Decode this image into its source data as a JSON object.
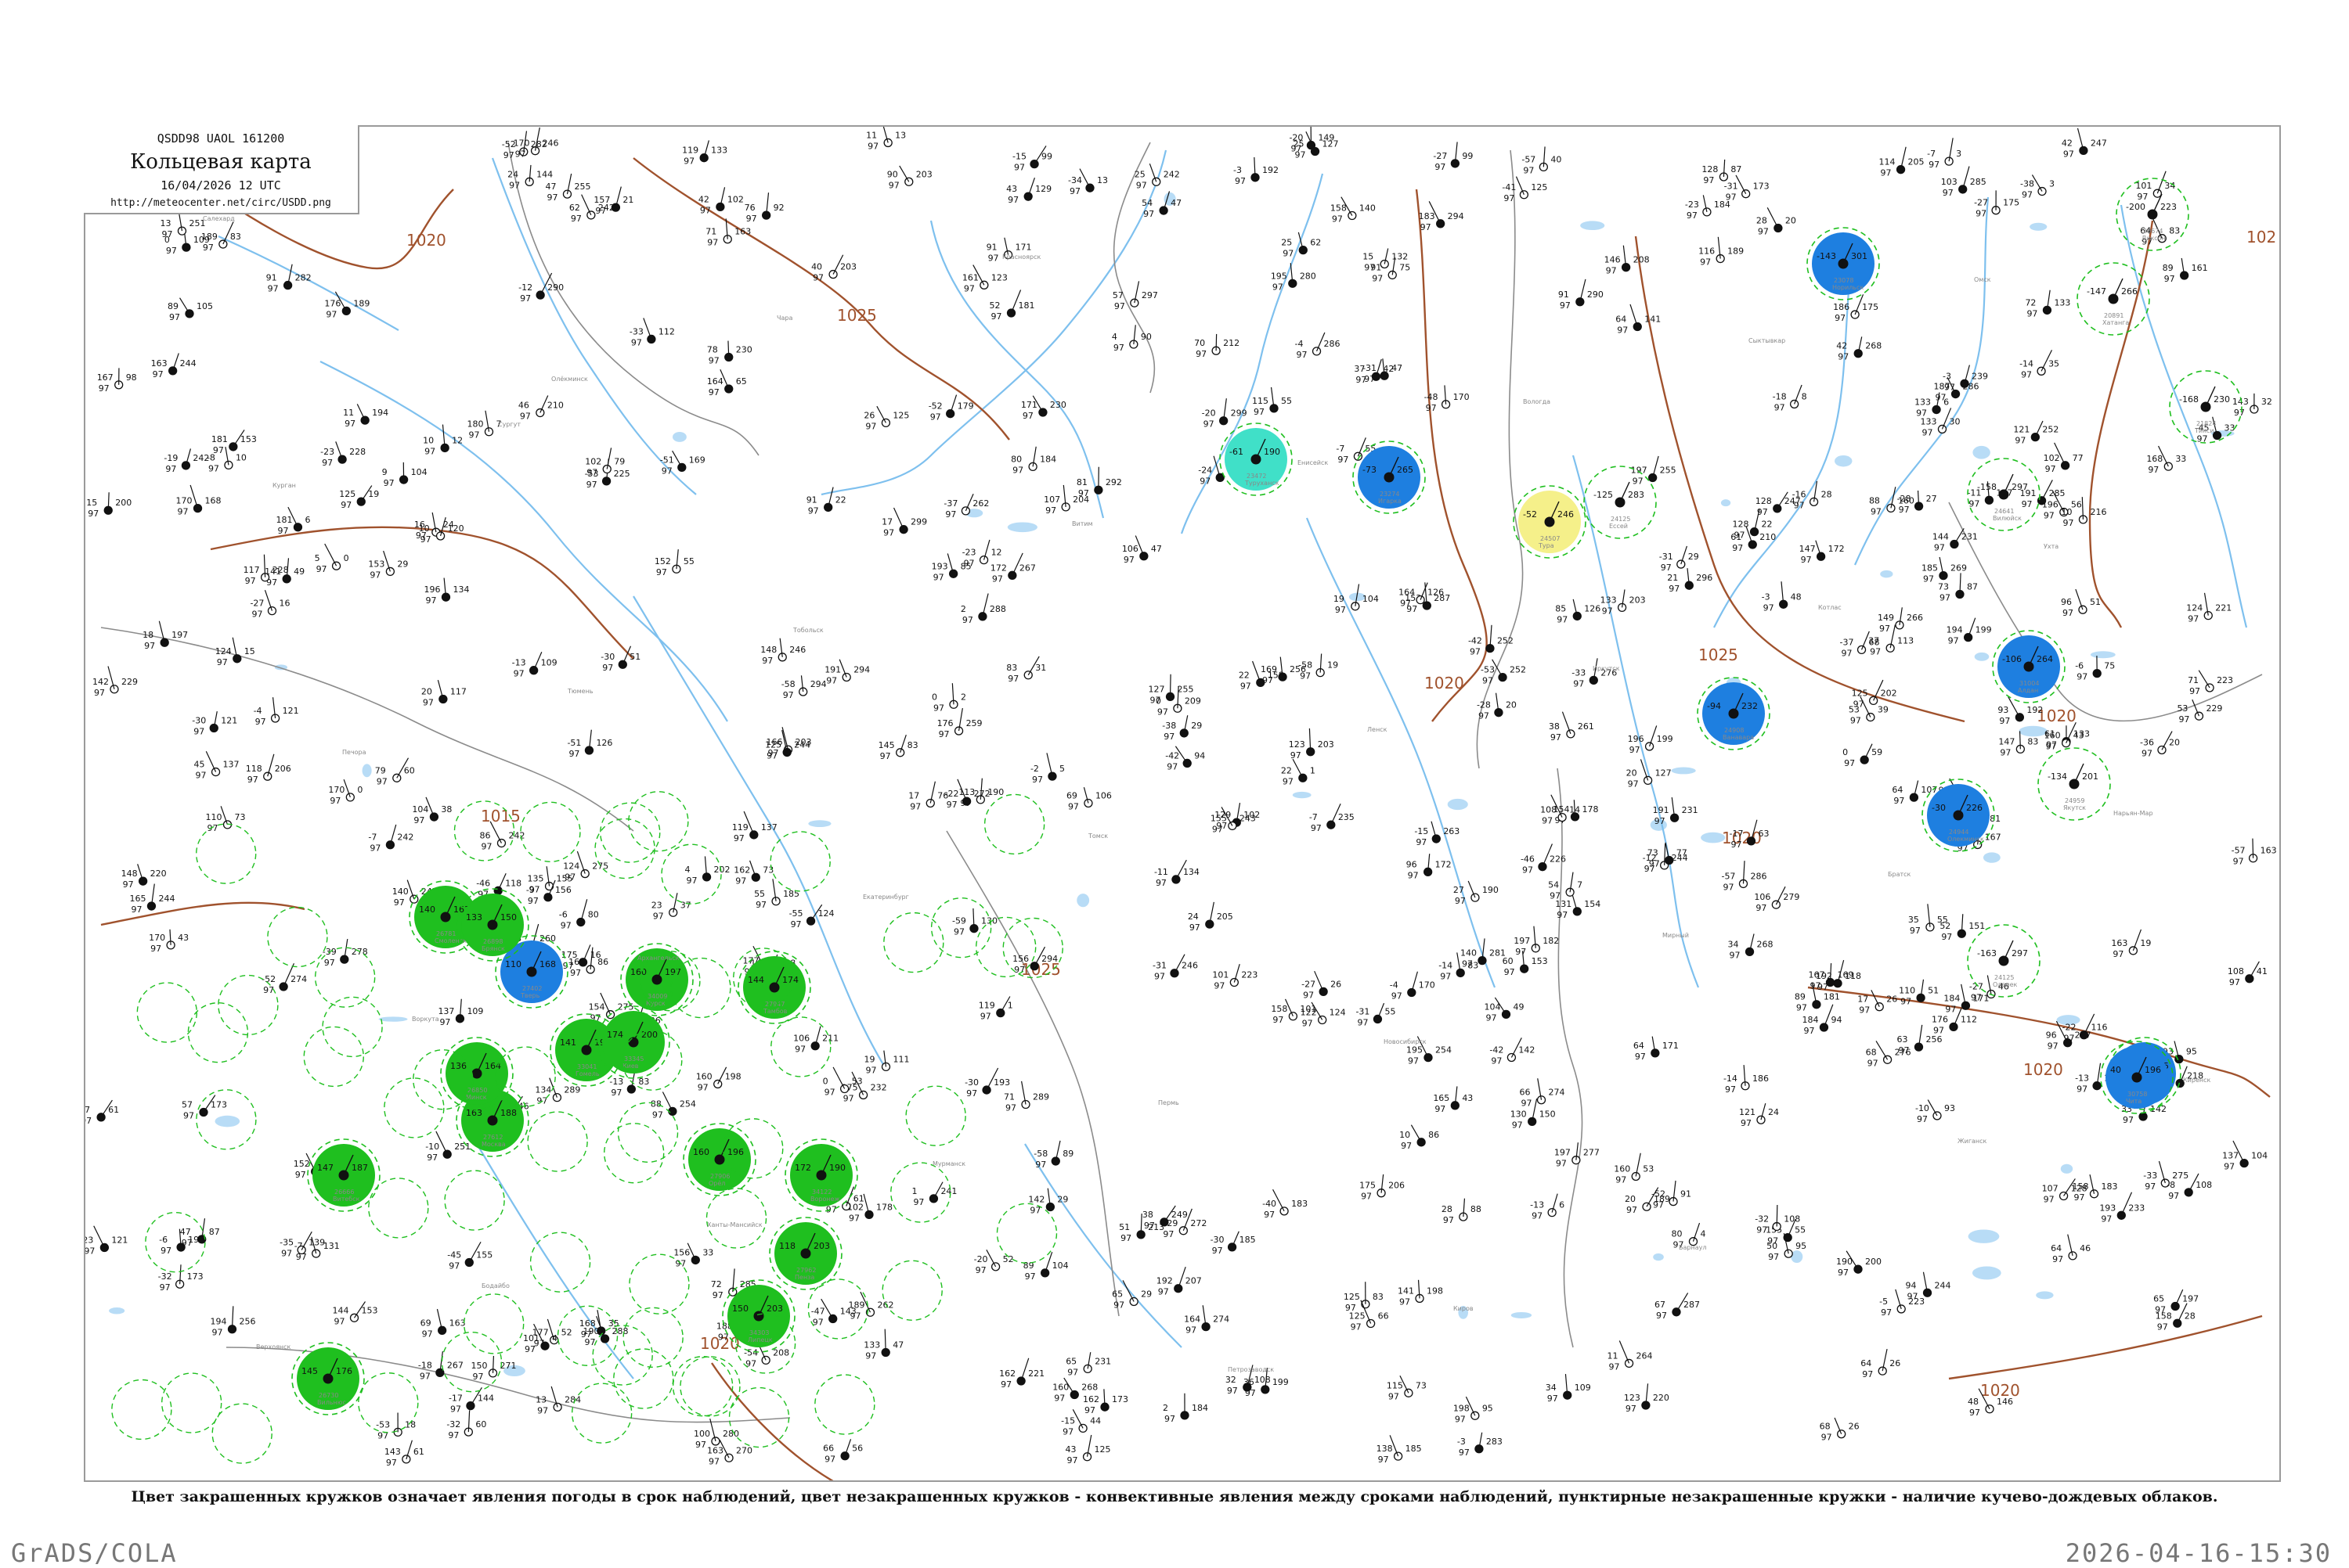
{
  "header": {
    "code_line": "QSDD98  UAOL  161200",
    "title": "Кольцевая карта",
    "datetime": "16/04/2026 12 UTC",
    "url": "http://meteocenter.net/circ/USDD.png"
  },
  "legend_note": "Цвет закрашенных кружков означает явления погоды в срок наблюдений, цвет незакрашенных кружков - конвективные явления между сроками наблюдений, пунктирные незакрашенные кружки - наличие кучево-дождевых облаков.",
  "footer": {
    "left": "GrADS/COLA",
    "right": "2026-04-16-15:30"
  },
  "colors": {
    "isobar": "#a0522d",
    "rivers": "#7ec0ee",
    "border": "#8b8b8b",
    "shower_fill": "#1fbf1f",
    "snow_fill": "#1e7fe0",
    "fog_fill": "#40e0c8",
    "haze_fill": "#f5f08a",
    "cb_ring": "#1fbf1f"
  },
  "isobars": [
    "1020",
    "1025",
    "1015",
    "1020",
    "1025",
    "1020",
    "1025",
    "1020",
    "1020",
    "1020",
    "1020",
    "102"
  ],
  "stations": [
    {
      "name": "Диксон",
      "t": "-200",
      "p": "223",
      "code": "20674",
      "fill": "none"
    },
    {
      "name": "Хатанга",
      "t": "-147",
      "p": "266",
      "code": "20891",
      "fill": "none"
    },
    {
      "name": "Тикси",
      "t": "-168",
      "p": "230",
      "code": "21824",
      "fill": "none"
    },
    {
      "name": "Норильск",
      "t": "-143",
      "p": "301",
      "code": "23078",
      "fill": "snow"
    },
    {
      "name": "Туруханск",
      "t": "-61",
      "p": "190",
      "code": "23472",
      "fill": "fog"
    },
    {
      "name": "Игарка",
      "t": "-73",
      "p": "265",
      "code": "23274",
      "fill": "snow"
    },
    {
      "name": "Тура",
      "t": "-52",
      "p": "246",
      "code": "24507",
      "fill": "haze"
    },
    {
      "name": "Ессей",
      "t": "-125",
      "p": "283",
      "code": "24125",
      "fill": "none"
    },
    {
      "name": "Вилюйск",
      "t": "-158",
      "p": "297",
      "code": "24641",
      "fill": "none"
    },
    {
      "name": "Якутск",
      "t": "-134",
      "p": "201",
      "code": "24959",
      "fill": "none"
    },
    {
      "name": "Оленек",
      "t": "-163",
      "p": "297",
      "code": "24125",
      "fill": "none"
    },
    {
      "name": "Ванавара",
      "t": "-94",
      "p": "232",
      "code": "24908",
      "fill": "snow"
    },
    {
      "name": "Алдан",
      "t": "-106",
      "p": "264",
      "code": "31004",
      "fill": "snow"
    },
    {
      "name": "Олекминск",
      "t": "-30",
      "p": "226",
      "code": "24944",
      "fill": "snow"
    },
    {
      "name": "Бомнак",
      "t": "-89",
      "p": "235",
      "code": "31137",
      "fill": "snow"
    },
    {
      "name": "Москва",
      "t": "163",
      "p": "188",
      "code": "27612",
      "fill": "shower"
    },
    {
      "name": "Тверь",
      "t": "110",
      "p": "168",
      "code": "27402",
      "fill": "snow"
    },
    {
      "name": "Смоленск",
      "t": "140",
      "p": "163",
      "code": "26781",
      "fill": "shower"
    },
    {
      "name": "Брянск",
      "t": "133",
      "p": "150",
      "code": "26898",
      "fill": "shower"
    },
    {
      "name": "Курск",
      "t": "160",
      "p": "197",
      "code": "34009",
      "fill": "shower"
    },
    {
      "name": "Орёл",
      "t": "160",
      "p": "196",
      "code": "27906",
      "fill": "shower"
    },
    {
      "name": "Воронеж",
      "t": "172",
      "p": "190",
      "code": "34122",
      "fill": "shower"
    },
    {
      "name": "Тамбов",
      "t": "144",
      "p": "174",
      "code": "27947",
      "fill": "shower"
    },
    {
      "name": "Липецк",
      "t": "150",
      "p": "203",
      "code": "34303",
      "fill": "shower"
    },
    {
      "name": "Пенза",
      "t": "118",
      "p": "203",
      "code": "27962",
      "fill": "shower"
    },
    {
      "name": "Минск",
      "t": "136",
      "p": "164",
      "code": "26850",
      "fill": "shower"
    },
    {
      "name": "Гомель",
      "t": "141",
      "p": "197",
      "code": "33041",
      "fill": "shower"
    },
    {
      "name": "Киев",
      "t": "174",
      "p": "200",
      "code": "33345",
      "fill": "shower"
    },
    {
      "name": "Витебск",
      "t": "147",
      "p": "187",
      "code": "26666",
      "fill": "shower"
    },
    {
      "name": "Вильнюс",
      "t": "145",
      "p": "176",
      "code": "26730",
      "fill": "shower"
    },
    {
      "name": "Чита",
      "t": "40",
      "p": "196",
      "code": "30758",
      "fill": "snow"
    }
  ],
  "place_names": [
    "Салехард",
    "Сургут",
    "Тобольск",
    "Томск",
    "Новосибирск",
    "Барнаул",
    "Омск",
    "Курган",
    "Тюмень",
    "Екатеринбург",
    "Пермь",
    "Киров",
    "Сыктывкар",
    "Ухта",
    "Печора",
    "Архангельск",
    "Мурманск",
    "Петрозаводск",
    "Вологда",
    "Котлас",
    "Нарьян-Мар",
    "Воркута",
    "Ханты-Мансийск",
    "Красноярск",
    "Енисейск",
    "Иркутск",
    "Братск",
    "Киренск",
    "Бодайбо",
    "Чара",
    "Витим",
    "Ленск",
    "Мирный",
    "Жиганск",
    "Верхоянск",
    "Олёкминск"
  ]
}
